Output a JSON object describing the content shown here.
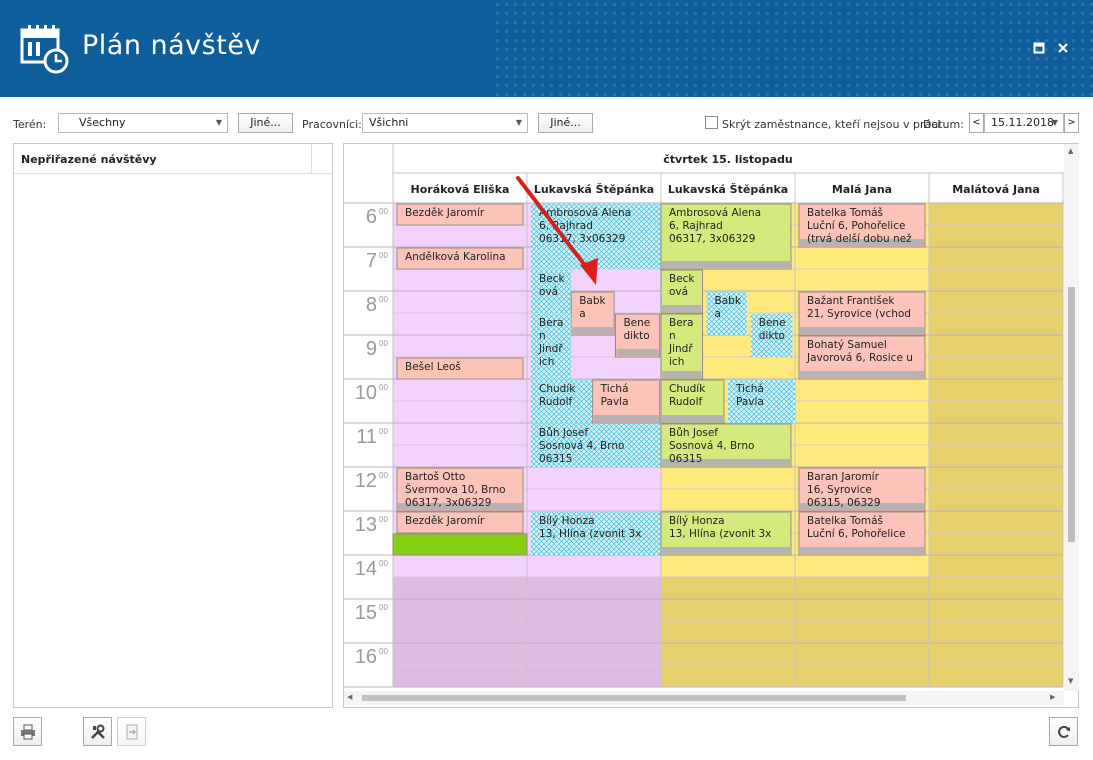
{
  "window": {
    "title": "Plán návštěv",
    "maximize_icon": "maximize-icon",
    "close_icon": "close-icon"
  },
  "filters": {
    "teren_label": "Terén:",
    "teren_value": "Všechny",
    "teren_other": "Jiné...",
    "pracovnici_label": "Pracovníci:",
    "pracovnici_value": "Všichni",
    "pracovnici_other": "Jiné...",
    "hide_label": "Skrýt zaměstnance, kteří nejsou v práci",
    "datum_label": "Datum:",
    "date_value": "15.11.2018",
    "prev": "<",
    "next": ">"
  },
  "left_panel": {
    "title": "Nepřiřazené návštěvy"
  },
  "calendar": {
    "day_header": "čtvrtek 15. listopadu",
    "hours": [
      "6",
      "7",
      "8",
      "9",
      "10",
      "11",
      "12",
      "13",
      "14",
      "15",
      "16"
    ],
    "hour_minutes": "00",
    "columns": [
      {
        "name": "Horáková Eliška",
        "bg": "#f1d3fb",
        "off": "#dbbcdf"
      },
      {
        "name": "Lukavská Štěpánka",
        "bg": "#f1d3fb",
        "off": "#dbbcdf"
      },
      {
        "name": "Lukavská Štěpánka",
        "bg": "#fde97c",
        "off": "#e5d06b"
      },
      {
        "name": "Malá Jana",
        "bg": "#fde97c",
        "off": "#e5d06b"
      },
      {
        "name": "Malátová Jana",
        "bg": "#e5d06b",
        "off": "#e5d06b"
      }
    ],
    "appointments": [
      {
        "col": 0,
        "lines": [
          "Bezděk Jaromír"
        ],
        "start": 6.0,
        "end": 6.5,
        "left": 0.03,
        "width": 0.94,
        "color": "#fcc3b9"
      },
      {
        "col": 0,
        "lines": [
          "Andělková Karolina"
        ],
        "start": 7.0,
        "end": 7.5,
        "left": 0.03,
        "width": 0.94,
        "color": "#fcc3b9"
      },
      {
        "col": 0,
        "lines": [
          "Bešel Leoš"
        ],
        "start": 9.5,
        "end": 10.0,
        "left": 0.03,
        "width": 0.94,
        "color": "#fcc3b9"
      },
      {
        "col": 0,
        "lines": [
          "Bartoš Otto",
          "Švermova 10, Brno",
          "06317, 3x06329"
        ],
        "start": 12.0,
        "end": 13.0,
        "left": 0.03,
        "width": 0.94,
        "color": "#fcc3b9"
      },
      {
        "col": 0,
        "lines": [
          "Bezděk Jaromír"
        ],
        "start": 13.0,
        "end": 13.5,
        "left": 0.03,
        "width": 0.94,
        "color": "#fcc3b9"
      },
      {
        "col": 0,
        "lines": [],
        "start": 13.5,
        "end": 14.0,
        "left": 0.0,
        "width": 1.0,
        "color": "#84cf10"
      },
      {
        "col": 1,
        "lines": [
          "Ambrosová Alena",
          "6, Rajhrad",
          "06317, 3x06329"
        ],
        "start": 6.0,
        "end": 7.5,
        "left": 0.03,
        "width": 0.97,
        "color": "hatch"
      },
      {
        "col": 1,
        "lines": [
          "Beck",
          "ová"
        ],
        "start": 7.5,
        "end": 8.5,
        "left": 0.03,
        "width": 0.3,
        "color": "hatch"
      },
      {
        "col": 1,
        "lines": [
          "Babk",
          "a"
        ],
        "start": 8.0,
        "end": 9.0,
        "left": 0.33,
        "width": 0.32,
        "color": "#fcc3b9"
      },
      {
        "col": 1,
        "lines": [
          "Bene",
          "dikto"
        ],
        "start": 8.5,
        "end": 9.5,
        "left": 0.66,
        "width": 0.33,
        "color": "#fcc3b9"
      },
      {
        "col": 1,
        "lines": [
          "Bera",
          "n",
          "Jindř",
          "ich"
        ],
        "start": 8.5,
        "end": 10.0,
        "left": 0.03,
        "width": 0.3,
        "color": "hatch"
      },
      {
        "col": 1,
        "lines": [
          "Chudík",
          "Rudolf"
        ],
        "start": 10.0,
        "end": 11.0,
        "left": 0.03,
        "width": 0.46,
        "color": "hatch"
      },
      {
        "col": 1,
        "lines": [
          "Tichá",
          "Pavla"
        ],
        "start": 10.0,
        "end": 11.0,
        "left": 0.49,
        "width": 0.5,
        "color": "#fcc3b9"
      },
      {
        "col": 1,
        "lines": [
          "Bůh Josef",
          "Sosnová 4, Brno",
          "06315"
        ],
        "start": 11.0,
        "end": 12.0,
        "left": 0.03,
        "width": 0.97,
        "color": "hatch"
      },
      {
        "col": 1,
        "lines": [
          "Bílý Honza",
          "13, Hlína (zvonit 3x"
        ],
        "start": 13.0,
        "end": 14.0,
        "left": 0.03,
        "width": 0.97,
        "color": "hatch"
      },
      {
        "col": 2,
        "lines": [
          "Ambrosová Alena",
          "6, Rajhrad",
          "06317, 3x06329"
        ],
        "start": 6.0,
        "end": 7.5,
        "left": 0.0,
        "width": 0.97,
        "color": "#d5ea7c"
      },
      {
        "col": 2,
        "lines": [
          "Beck",
          "ová"
        ],
        "start": 7.5,
        "end": 8.5,
        "left": 0.0,
        "width": 0.31,
        "color": "#d5ea7c"
      },
      {
        "col": 2,
        "lines": [
          "Babk",
          "a"
        ],
        "start": 8.0,
        "end": 9.0,
        "left": 0.34,
        "width": 0.3,
        "color": "hatch"
      },
      {
        "col": 2,
        "lines": [
          "Bene",
          "dikto"
        ],
        "start": 8.5,
        "end": 9.5,
        "left": 0.67,
        "width": 0.31,
        "color": "hatch"
      },
      {
        "col": 2,
        "lines": [
          "Bera",
          "n",
          "Jindř",
          "ich"
        ],
        "start": 8.5,
        "end": 10.0,
        "left": 0.0,
        "width": 0.31,
        "color": "#d5ea7c"
      },
      {
        "col": 2,
        "lines": [
          "Chudík",
          "Rudolf"
        ],
        "start": 10.0,
        "end": 11.0,
        "left": 0.0,
        "width": 0.47,
        "color": "#d5ea7c"
      },
      {
        "col": 2,
        "lines": [
          "Tichá",
          "Pavla"
        ],
        "start": 10.0,
        "end": 11.0,
        "left": 0.5,
        "width": 0.5,
        "color": "hatch"
      },
      {
        "col": 2,
        "lines": [
          "Bůh Josef",
          "Sosnová 4, Brno",
          "06315"
        ],
        "start": 11.0,
        "end": 12.0,
        "left": 0.0,
        "width": 0.97,
        "color": "#d5ea7c"
      },
      {
        "col": 2,
        "lines": [
          "Bílý Honza",
          "13, Hlína (zvonit 3x"
        ],
        "start": 13.0,
        "end": 14.0,
        "left": 0.0,
        "width": 0.97,
        "color": "#d5ea7c"
      },
      {
        "col": 3,
        "lines": [
          "Batelka Tomáš",
          "Luční 6, Pohořelice",
          "(trvá delší dobu než"
        ],
        "start": 6.0,
        "end": 7.0,
        "left": 0.03,
        "width": 0.94,
        "color": "#fcc3b9"
      },
      {
        "col": 3,
        "lines": [
          "Bažant František",
          "21, Syrovice (vchod"
        ],
        "start": 8.0,
        "end": 9.0,
        "left": 0.03,
        "width": 0.94,
        "color": "#fcc3b9"
      },
      {
        "col": 3,
        "lines": [
          "Bohatý Samuel",
          "Javorová 6, Rosice u"
        ],
        "start": 9.0,
        "end": 10.0,
        "left": 0.03,
        "width": 0.94,
        "color": "#fcc3b9"
      },
      {
        "col": 3,
        "lines": [
          "Baran Jaromír",
          "16, Syrovice",
          "06315, 06329"
        ],
        "start": 12.0,
        "end": 13.0,
        "left": 0.03,
        "width": 0.94,
        "color": "#fcc3b9"
      },
      {
        "col": 3,
        "lines": [
          "Batelka Tomáš",
          "Luční 6, Pohořelice"
        ],
        "start": 13.0,
        "end": 14.0,
        "left": 0.03,
        "width": 0.94,
        "color": "#fcc3b9"
      }
    ]
  },
  "toolbar": {
    "print_icon": "printer-icon",
    "settings_icon": "tools-icon",
    "export_icon": "export-icon",
    "refresh_icon": "refresh-icon"
  }
}
